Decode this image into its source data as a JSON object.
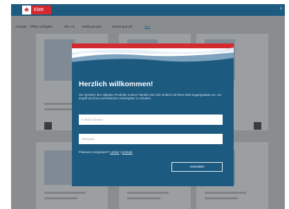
{
  "brand": {
    "name": "Klett",
    "mark": "♣"
  },
  "topbar": {
    "corner_text": "≡"
  },
  "filters": {
    "items": [
      "Anzeige:",
      "Offline verfügbar",
      "Alle A-Z",
      "Häufig genutzt",
      "Zuletzt genutzt",
      "Neu"
    ],
    "active": "Neu"
  },
  "modal": {
    "title": "Herzlich willkommen!",
    "intro": "Sie möchten Ihre digitalen Produkte nutzen? Melden Sie sich einfach mit Ihren Klett Zugangsdaten an, um Zugriff auf Ihren persönlichen Arbeitsplatz zu erhalten.",
    "email_placeholder": "E-Mail-Adresse",
    "password_placeholder": "Passwort",
    "forgot_text": "Passwort vergessen?",
    "link_teacher": "Lehrer",
    "separator": "|",
    "link_student": "Schüler",
    "login_label": "Anmelden"
  },
  "colors": {
    "accent": "#1d5a80",
    "brand_red": "#d22a2e",
    "overlay": "#8a8d90"
  }
}
